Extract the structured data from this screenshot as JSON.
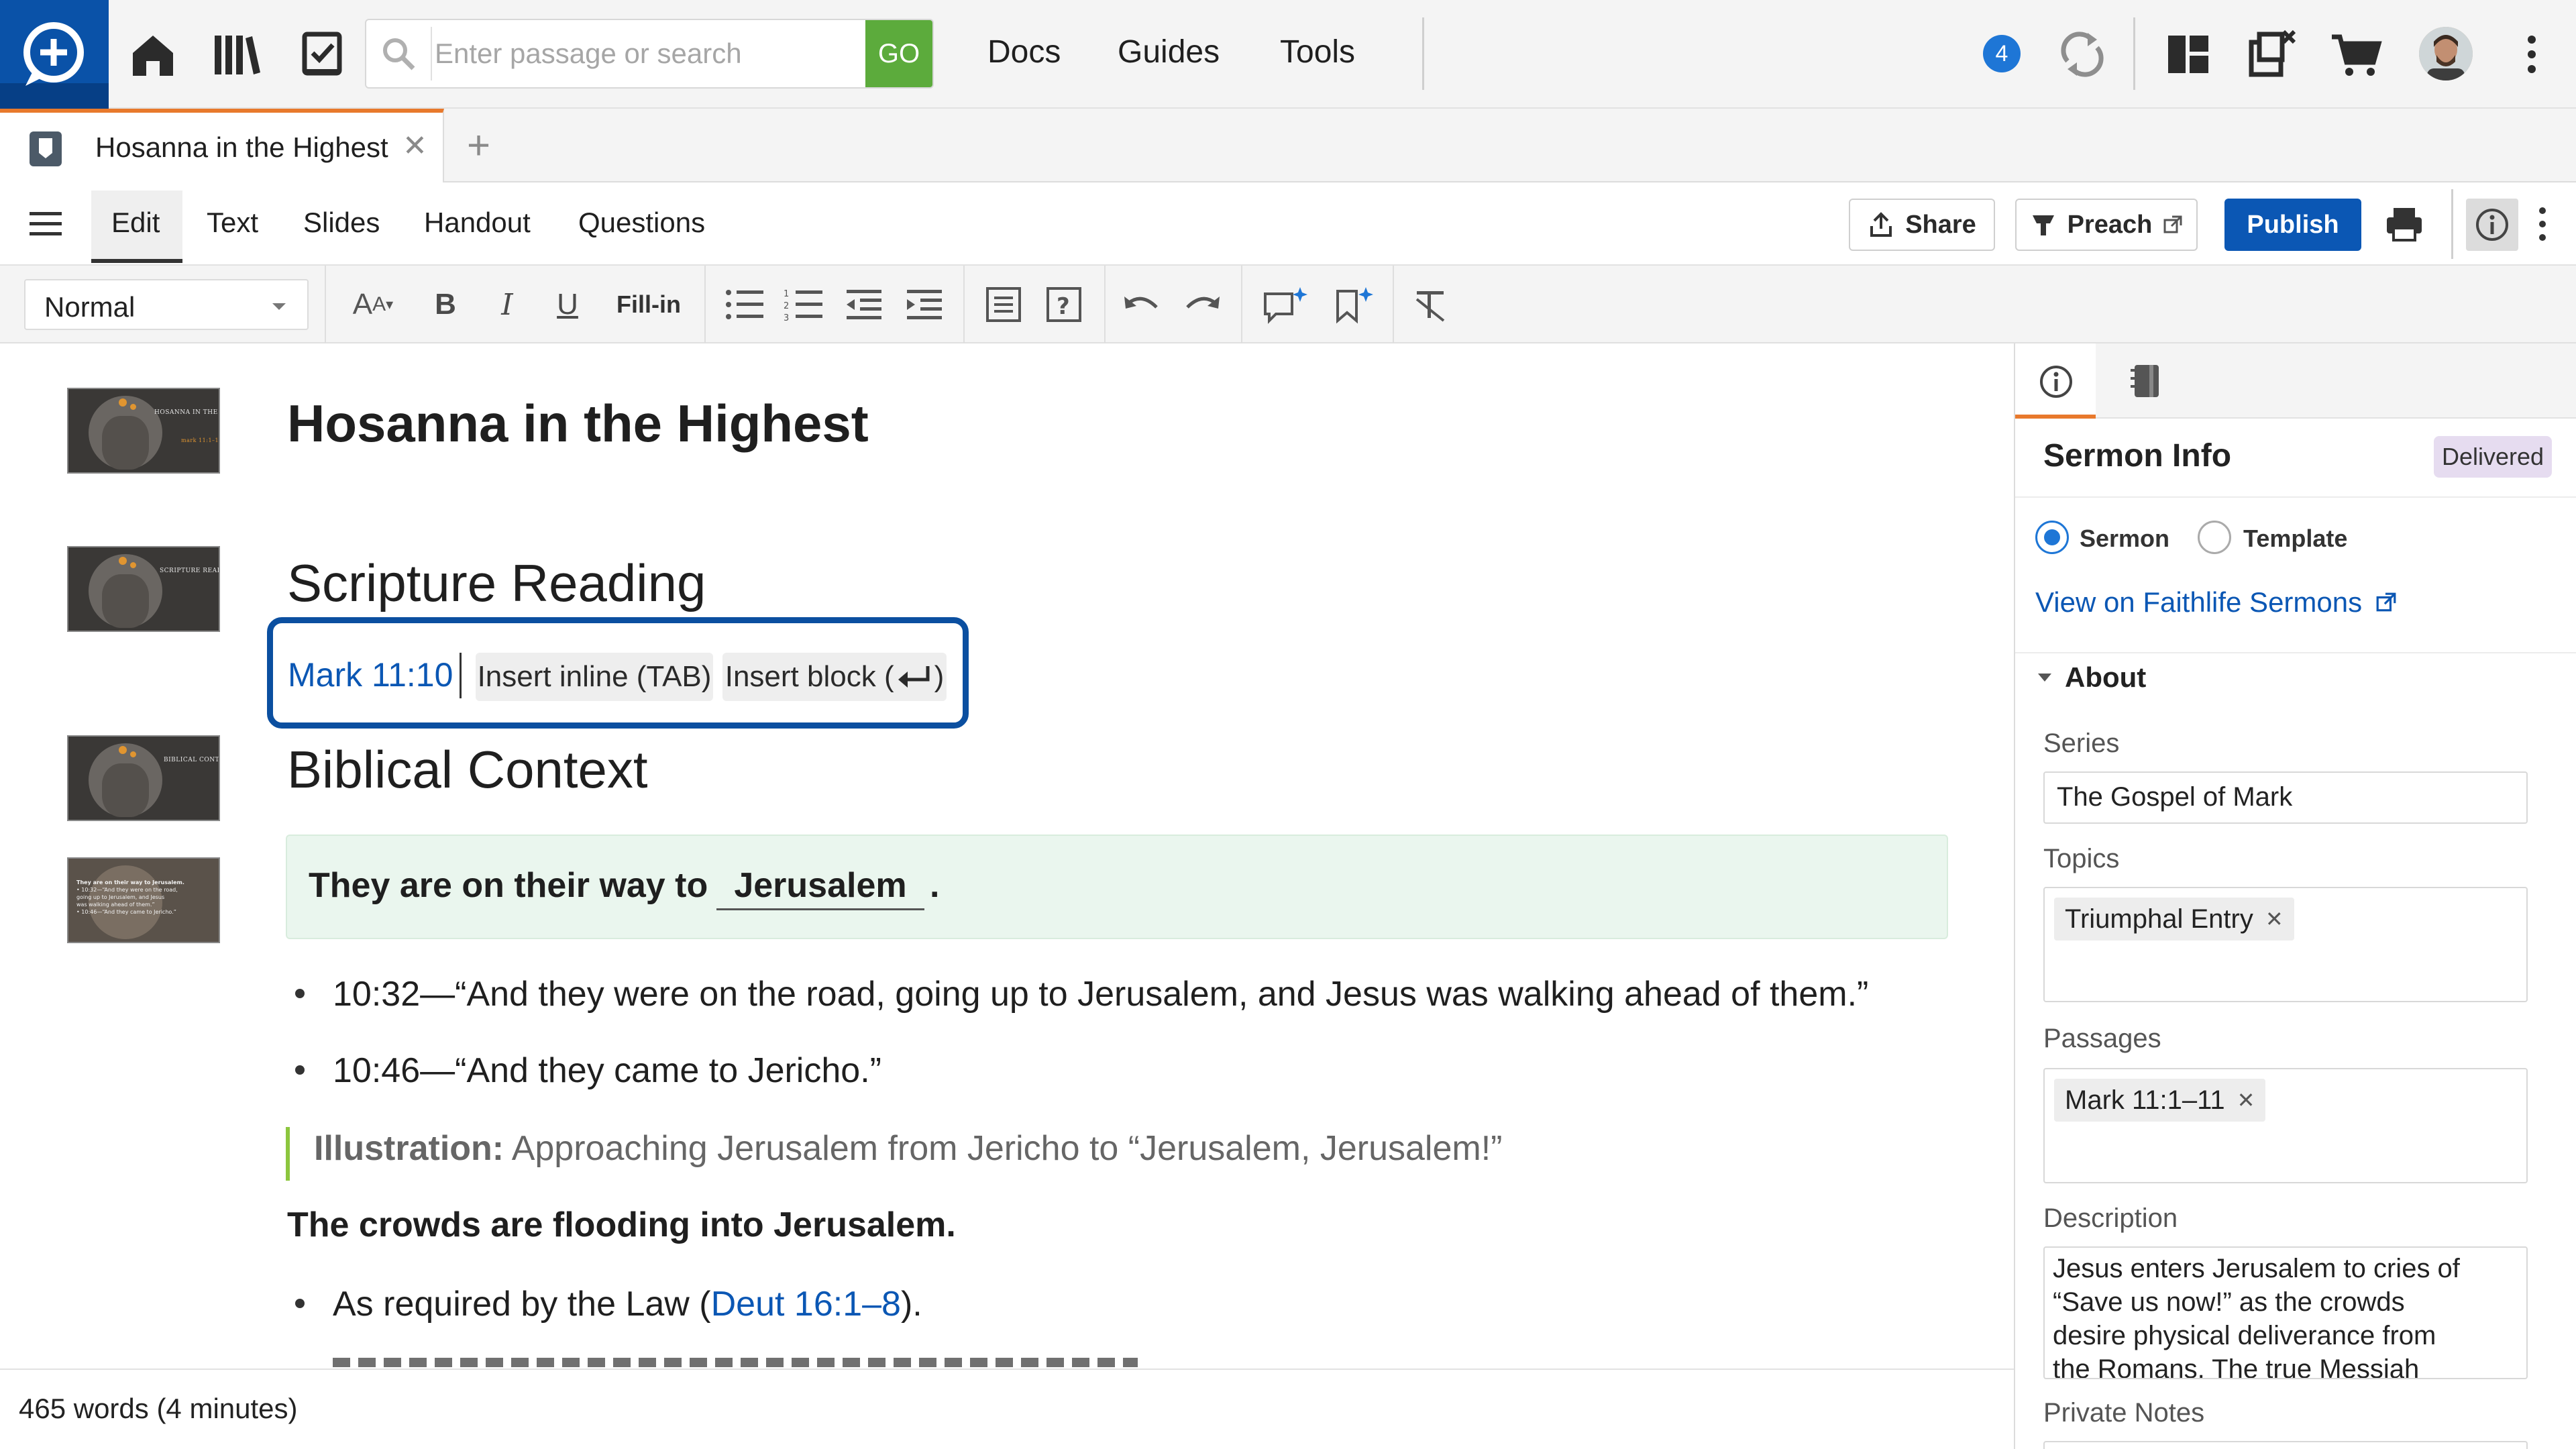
{
  "topbar": {
    "search_placeholder": "Enter passage or search",
    "go_label": "GO",
    "nav": [
      "Docs",
      "Guides",
      "Tools"
    ],
    "notification_count": "4"
  },
  "tab": {
    "title": "Hosanna in the Highest"
  },
  "menu": {
    "items": [
      "Edit",
      "Text",
      "Slides",
      "Handout",
      "Questions"
    ],
    "share_label": "Share",
    "preach_label": "Preach",
    "publish_label": "Publish"
  },
  "toolbar": {
    "style_select": "Normal",
    "fill_in_label": "Fill-in"
  },
  "document": {
    "title": "Hosanna in the Highest",
    "scripture_heading": "Scripture Reading",
    "scripture_ref": "Mark 11:10",
    "insert_inline": "Insert inline (TAB)",
    "insert_block": "Insert block (",
    "insert_block_end": ")",
    "context_heading": "Biblical Context",
    "fillin_prefix": "They are on their way to",
    "fillin_answer": "Jerusalem",
    "fillin_suffix": ".",
    "bullet1": "10:32—“And they were on the road, going up to Jerusalem, and Jesus was walking ahead of them.”",
    "bullet2": "10:46—“And they came to Jericho.”",
    "illustration_label": "Illustration:",
    "illustration_text": "Approaching Jerusalem from Jericho to “Jerusalem, Jerusalem!”",
    "crowds_heading": "The crowds are flooding into Jerusalem.",
    "bullet3_prefix": "As required by the Law (",
    "bullet3_link": "Deut 16:1–8",
    "bullet3_suffix": ").",
    "thumb1_text": "HOSANNA IN THE HIGHEST",
    "thumb1_sub": "mark 11:1–11",
    "thumb2_text": "SCRIPTURE READING",
    "thumb3_text": "BIBLICAL CONTEXT",
    "thumb4_lines": [
      "They are on their way to Jerusalem.",
      "• 10:32—“And they were on the road,",
      "going up to Jerusalem, and Jesus",
      "was walking ahead of them.”",
      "• 10:46—“And they came to Jericho.”"
    ]
  },
  "footer": {
    "word_count": "465 words (4 minutes)"
  },
  "panel": {
    "title": "Sermon Info",
    "status_badge": "Delivered",
    "radio_sermon": "Sermon",
    "radio_template": "Template",
    "sermon_selected": true,
    "view_link": "View on Faithlife Sermons",
    "about_heading": "About",
    "series_label": "Series",
    "series_value": "The Gospel of Mark",
    "topics_label": "Topics",
    "topics_chips": [
      "Triumphal Entry"
    ],
    "passages_label": "Passages",
    "passages_chips": [
      "Mark 11:1–11"
    ],
    "description_label": "Description",
    "description_lines": [
      "Jesus enters Jerusalem to cries of",
      "“Save us now!” as the crowds",
      "desire physical deliverance from",
      "the Romans. The true Messiah"
    ],
    "private_notes_label": "Private Notes"
  },
  "colors": {
    "accent_blue": "#0a52a8",
    "publish_blue": "#0b57b4",
    "go_green": "#5cab3c",
    "tab_orange": "#e8792c",
    "fillin_bg": "#eaf6ee",
    "illustration_bar": "#8cc63e",
    "badge_bg": "#e6dcf0",
    "link_blue": "#0b57b4"
  },
  "icons": [
    "search-icon",
    "home-icon",
    "library-icon",
    "checklist-icon",
    "sync-icon",
    "layout-icon",
    "export-icon",
    "cart-icon",
    "more-vertical-icon",
    "hamburger-icon",
    "print-icon",
    "info-icon",
    "bookmark-icon"
  ]
}
